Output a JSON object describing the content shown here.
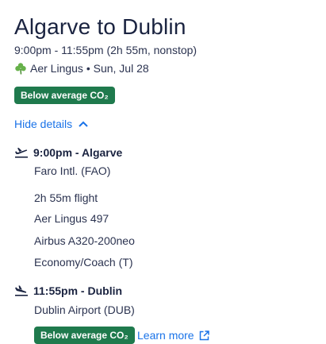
{
  "header": {
    "title": "Algarve to Dublin",
    "times": "9:00pm - 11:55pm (2h 55m, nonstop)",
    "airline_date": "Aer Lingus • Sun, Jul 28"
  },
  "badge_label": "Below average CO₂",
  "hide_details": "Hide details",
  "departure": {
    "time_place": "9:00pm - Algarve",
    "airport": "Faro Intl. (FAO)"
  },
  "flight": {
    "duration": "2h 55m flight",
    "number": "Aer Lingus 497",
    "aircraft": "Airbus A320-200neo",
    "cabin": "Economy/Coach (T)"
  },
  "arrival": {
    "time_place": "11:55pm - Dublin",
    "airport": "Dublin Airport (DUB)"
  },
  "learn_more": "Learn more",
  "colors": {
    "badge": "#1f7a4d",
    "link": "#1a73e8",
    "clover": "#66b14a"
  }
}
